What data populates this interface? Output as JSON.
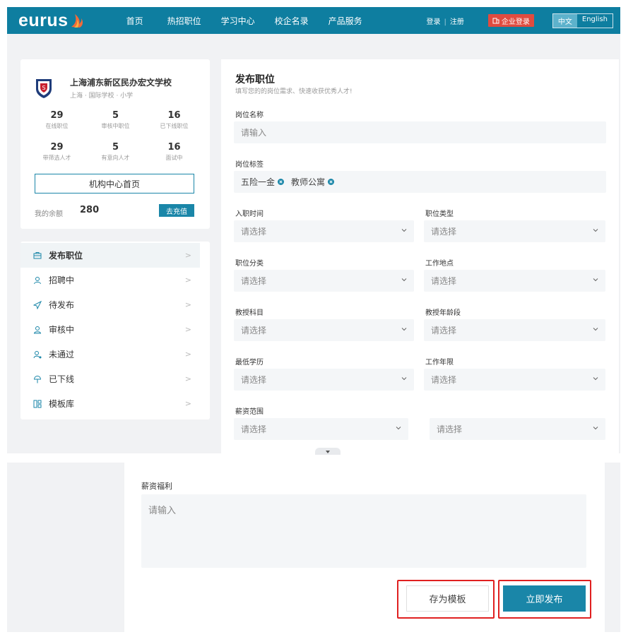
{
  "header": {
    "logo": "eurus",
    "nav": [
      "首页",
      "热招职位",
      "学习中心",
      "校企名录",
      "产品服务"
    ],
    "login": "登录",
    "register": "注册",
    "enterprise_login": "企业登录",
    "lang_cn": "中文",
    "lang_en": "English"
  },
  "profile": {
    "school_name": "上海浦东新区民办宏文学校",
    "school_meta": "上海 · 国际学校 · 小学",
    "stats_row1": [
      {
        "num": "29",
        "label": "在线职位"
      },
      {
        "num": "5",
        "label": "审核中职位"
      },
      {
        "num": "16",
        "label": "已下线职位"
      }
    ],
    "stats_row2": [
      {
        "num": "29",
        "label": "带筛选人才"
      },
      {
        "num": "5",
        "label": "有意向人才"
      },
      {
        "num": "16",
        "label": "面试中"
      }
    ],
    "org_home_button": "机构中心首页",
    "balance_label": "我的余额",
    "balance_value": "280",
    "recharge_button": "去充值"
  },
  "menu": [
    {
      "label": "发布职位",
      "icon": "briefcase-icon",
      "active": true
    },
    {
      "label": "招聘中",
      "icon": "person-icon"
    },
    {
      "label": "待发布",
      "icon": "send-icon"
    },
    {
      "label": "审核中",
      "icon": "person-review-icon"
    },
    {
      "label": "未通过",
      "icon": "person-reject-icon"
    },
    {
      "label": "已下线",
      "icon": "offline-icon"
    },
    {
      "label": "模板库",
      "icon": "template-icon"
    }
  ],
  "chevron": ">",
  "form": {
    "title": "发布职位",
    "subtitle": "填写您的的岗位需求、快速收获优秀人才!",
    "job_name_label": "岗位名称",
    "input_placeholder": "请输入",
    "tags_label": "岗位标签",
    "tags": [
      "五险一金",
      "教师公寓"
    ],
    "select_placeholder": "请选择",
    "fields": {
      "entry_time": "入职时间",
      "job_type": "职位类型",
      "job_category": "职位分类",
      "work_location": "工作地点",
      "subject": "教授科目",
      "grade": "教授年龄段",
      "education": "最低学历",
      "experience": "工作年限",
      "salary_range": "薪资范围"
    },
    "welfare_label": "薪资福利",
    "save_template_button": "存为模板",
    "publish_button": "立即发布"
  }
}
